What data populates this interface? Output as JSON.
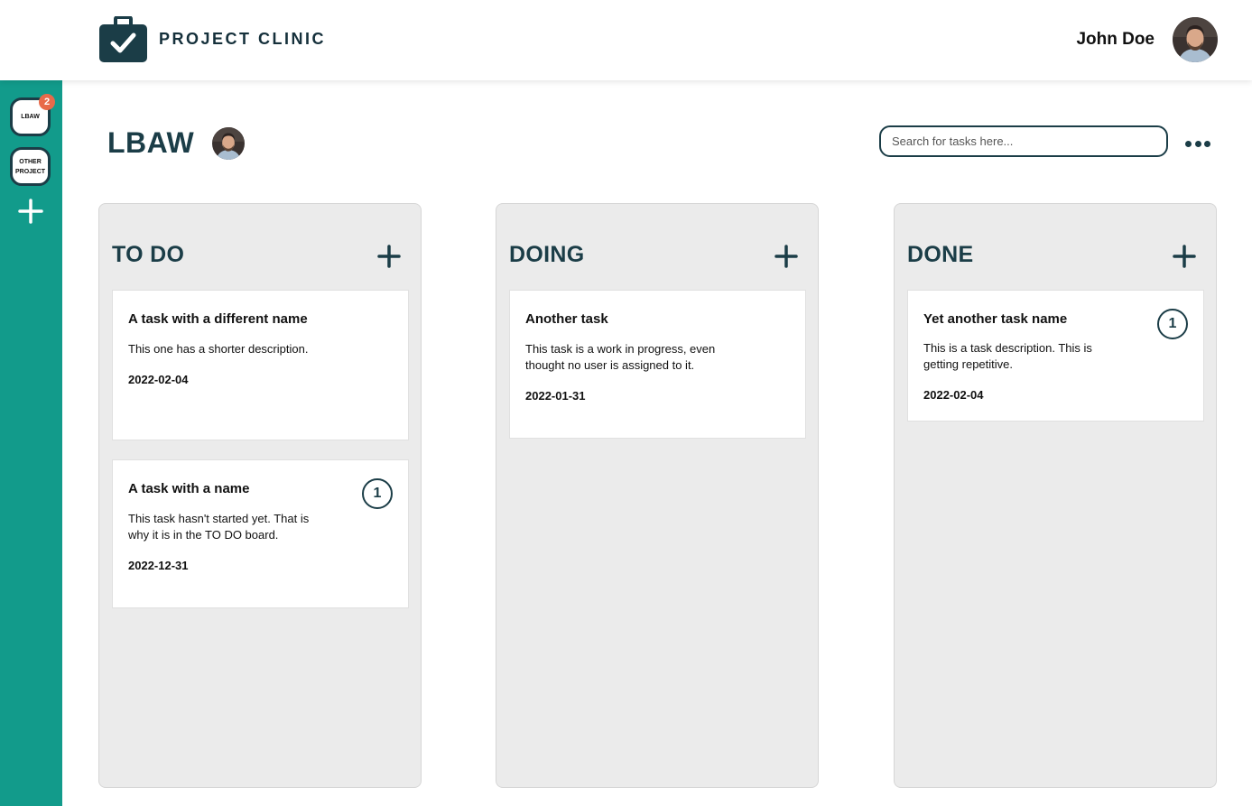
{
  "app": {
    "name": "PROJECT CLINIC",
    "logo_icon": "briefcase-check-icon"
  },
  "user": {
    "name": "John Doe",
    "avatar_icon": "user-avatar"
  },
  "sidebar": {
    "projects": [
      {
        "label": "LBAW",
        "badge": "2"
      },
      {
        "label": "OTHER PROJECT",
        "badge": ""
      }
    ],
    "add_icon": "plus-icon"
  },
  "project": {
    "title": "LBAW",
    "member_avatar": "user-avatar"
  },
  "search": {
    "placeholder": "Search for tasks here...",
    "value": ""
  },
  "more_icon": "ellipsis-icon",
  "colors": {
    "sidebar": "#129b8b",
    "primary": "#1b3d47",
    "column_bg": "#ebebeb",
    "badge": "#e86a4a"
  },
  "columns": [
    {
      "title": "TO DO",
      "cards": [
        {
          "title": "A task with a different name",
          "description": "This one has a shorter description.",
          "date": "2022-02-04",
          "assignees": ""
        },
        {
          "title": "A task with a name",
          "description": "This task hasn't started yet. That is why it is in the TO DO board.",
          "date": "2022-12-31",
          "assignees": "1"
        }
      ]
    },
    {
      "title": "DOING",
      "cards": [
        {
          "title": "Another task",
          "description": "This task is a work in progress, even thought no user is assigned to it.",
          "date": "2022-01-31",
          "assignees": ""
        }
      ]
    },
    {
      "title": "DONE",
      "cards": [
        {
          "title": "Yet another task name",
          "description": "This is a task description. This is getting repetitive.",
          "date": "2022-02-04",
          "assignees": "1"
        }
      ]
    }
  ]
}
